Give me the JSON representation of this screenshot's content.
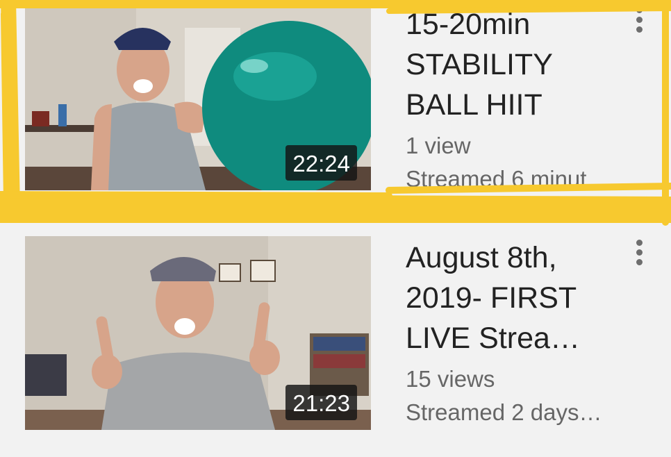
{
  "videos": [
    {
      "title_lines": [
        "15-20min",
        "STABILITY",
        "BALL HIIT"
      ],
      "views": "1 view",
      "streamed": "Streamed 6 minut…",
      "duration": "22:24"
    },
    {
      "title_lines": [
        "August 8th,",
        "2019- FIRST",
        "LIVE Strea…"
      ],
      "views": "15 views",
      "streamed": "Streamed 2 days…",
      "duration": "21:23"
    }
  ],
  "icons": {
    "menu": "more-vert-icon"
  },
  "colors": {
    "highlight": "#f7c92f",
    "background": "#f2f2f2",
    "duration_badge": "#141414",
    "ball": "#0f8b7e"
  }
}
